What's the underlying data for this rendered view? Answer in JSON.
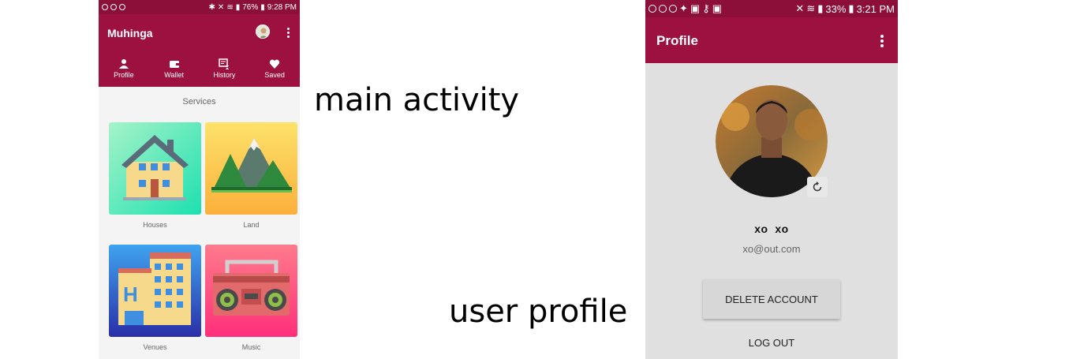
{
  "main_activity": {
    "status_bar": {
      "battery": "76%",
      "time": "9:28 PM"
    },
    "app_title": "Muhinga",
    "tabs": [
      {
        "label": "Profile",
        "icon": "person-icon"
      },
      {
        "label": "Wallet",
        "icon": "wallet-icon"
      },
      {
        "label": "History",
        "icon": "history-icon"
      },
      {
        "label": "Saved",
        "icon": "heart-icon"
      }
    ],
    "services_title": "Services",
    "services": [
      {
        "label": "Houses",
        "icon": "house-icon"
      },
      {
        "label": "Land",
        "icon": "mountains-icon"
      },
      {
        "label": "Venues",
        "icon": "hotel-icon"
      },
      {
        "label": "Music",
        "icon": "boombox-icon"
      }
    ]
  },
  "user_profile": {
    "status_bar": {
      "battery": "33%",
      "time": "3:21 PM"
    },
    "app_title": "Profile",
    "user_name": "xo  xo",
    "user_email": "xo@out.com",
    "delete_label": "DELETE ACCOUNT",
    "logout_label": "LOG OUT"
  },
  "captions": {
    "main": "main activity",
    "profile": "user profile"
  },
  "colors": {
    "status_bar": "#8c0f3a",
    "app_bar": "#9c1140",
    "profile_background": "#e0e0e0"
  }
}
